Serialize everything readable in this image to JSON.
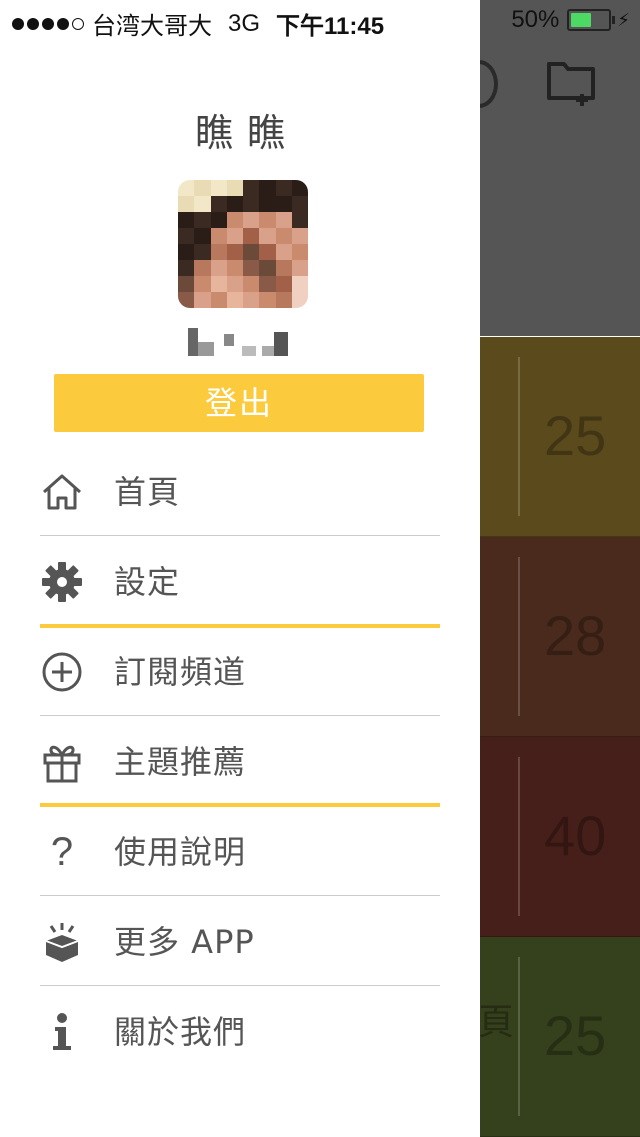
{
  "status_bar": {
    "carrier": "台湾大哥大",
    "network": "3G",
    "time": "下午11:45",
    "battery": "50%"
  },
  "drawer": {
    "username": "瞧瞧",
    "logout_label": "登出",
    "menu": [
      {
        "label": "首頁",
        "icon": "home-icon"
      },
      {
        "label": "設定",
        "icon": "gear-icon"
      },
      {
        "label": "訂閱頻道",
        "icon": "plus-circle-icon"
      },
      {
        "label": "主題推薦",
        "icon": "gift-icon"
      },
      {
        "label": "使用說明",
        "icon": "question-icon"
      },
      {
        "label": "更多 APP",
        "icon": "box-icon"
      },
      {
        "label": "關於我們",
        "icon": "info-icon"
      }
    ]
  },
  "background_tiles": [
    {
      "count": "25",
      "color": "#5a4a1c"
    },
    {
      "count": "28",
      "color": "#4a2a1c"
    },
    {
      "count": "40",
      "color": "#471f1a"
    },
    {
      "count": "25",
      "color": "#35401c",
      "partial_text": "頁"
    }
  ],
  "colors": {
    "accent": "#fccb3d",
    "header_gray": "#555555"
  }
}
